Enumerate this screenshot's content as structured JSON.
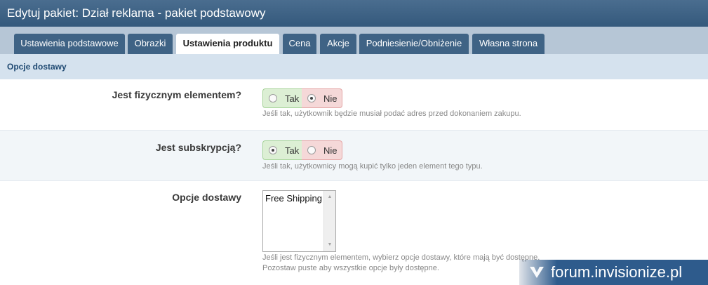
{
  "title": "Edytuj pakiet: Dział reklama - pakiet podstawowy",
  "tabs": [
    {
      "label": "Ustawienia podstawowe"
    },
    {
      "label": "Obrazki"
    },
    {
      "label": "Ustawienia produktu",
      "active": true
    },
    {
      "label": "Cena"
    },
    {
      "label": "Akcje"
    },
    {
      "label": "Podniesienie/Obniżenie"
    },
    {
      "label": "Własna strona"
    }
  ],
  "section_header": "Opcje dostawy",
  "fields": {
    "physical": {
      "label": "Jest fizycznym elementem?",
      "yes_label": "Tak",
      "no_label": "Nie",
      "selected": "Nie",
      "help": "Jeśli tak, użytkownik będzie musiał podać adres przed dokonaniem zakupu."
    },
    "subscription": {
      "label": "Jest subskrypcją?",
      "yes_label": "Tak",
      "no_label": "Nie",
      "selected": "Tak",
      "help": "Jeśli tak, użytkownicy mogą kupić tylko jeden element tego typu."
    },
    "shipping": {
      "label": "Opcje dostawy",
      "options": [
        "Free Shipping"
      ],
      "help_line1": "Jeśli jest fizycznym elementem, wybierz opcje dostawy, które mają być dostępne.",
      "help_line2": "Pozostaw puste aby wszystkie opcje były dostępne."
    }
  },
  "watermark": "forum.invisionize.pl",
  "colors": {
    "title_bar": "#3f6385",
    "tab_inactive": "#3f6385",
    "yes_green": "#dcefd4",
    "no_red": "#f5d8d8"
  }
}
